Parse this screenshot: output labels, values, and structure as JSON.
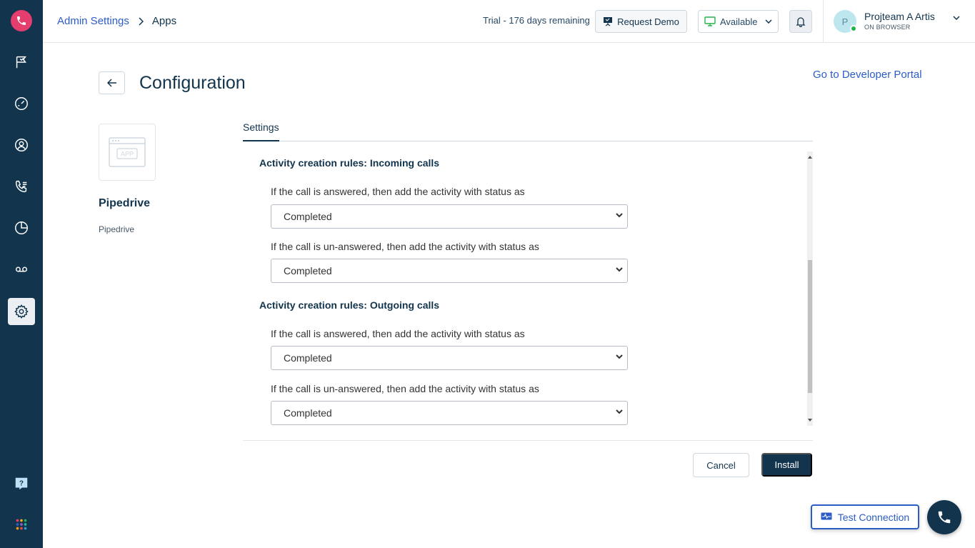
{
  "header": {
    "breadcrumb_parent": "Admin Settings",
    "breadcrumb_current": "Apps",
    "trial_text": "Trial - 176 days remaining",
    "request_demo_label": "Request Demo",
    "status_label": "Available",
    "user_initial": "P",
    "user_name": "Projteam A Artis",
    "user_sub": "ON BROWSER"
  },
  "page": {
    "title": "Configuration",
    "developer_portal_link": "Go to Developer Portal"
  },
  "app": {
    "name": "Pipedrive",
    "subtitle": "Pipedrive",
    "placeholder_text": "APP"
  },
  "tabs": [
    {
      "label": "Settings",
      "active": true
    }
  ],
  "sections": [
    {
      "title": "Activity creation rules: Incoming calls",
      "fields": [
        {
          "label": "If the call is answered, then add the activity with status as",
          "value": "Completed"
        },
        {
          "label": "If the call is un-answered, then add the activity with status as",
          "value": "Completed"
        }
      ]
    },
    {
      "title": "Activity creation rules: Outgoing calls",
      "fields": [
        {
          "label": "If the call is answered, then add the activity with status as",
          "value": "Completed"
        },
        {
          "label": "If the call is un-answered, then add the activity with status as",
          "value": "Completed"
        }
      ]
    }
  ],
  "footer": {
    "cancel_label": "Cancel",
    "install_label": "Install"
  },
  "floating": {
    "test_connection_label": "Test Connection",
    "help_label": "?"
  },
  "colors": {
    "sidebar": "#12344d",
    "logo": "#e43e6f",
    "link": "#2c5cc5",
    "online": "#24b34b"
  },
  "sidebar_icons": [
    "phone-logo-icon",
    "flag-icon",
    "dashboard-gauge-icon",
    "contact-icon",
    "call-list-icon",
    "reports-icon",
    "voicemail-icon",
    "settings-gear-icon",
    "help-icon",
    "apps-grid-icon"
  ]
}
